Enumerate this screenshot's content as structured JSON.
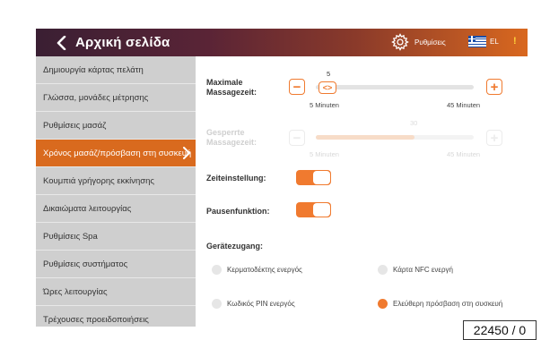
{
  "header": {
    "back_label": "Αρχική σελίδα",
    "settings_label": "Ρυθμίσεις",
    "lang_label": "EL",
    "info_glyph": "!"
  },
  "sidebar": {
    "items": [
      {
        "label": "Δημιουργία κάρτας πελάτη"
      },
      {
        "label": "Γλώσσα, μονάδες μέτρησης"
      },
      {
        "label": "Ρυθμίσεις μασάζ"
      },
      {
        "label": "Χρόνος μασάζ/πρόσβαση στη συσκευή",
        "active": true
      },
      {
        "label": "Κουμπιά γρήγορης εκκίνησης"
      },
      {
        "label": "Δικαιώματα λειτουργίας"
      },
      {
        "label": "Ρυθμίσεις Spa"
      },
      {
        "label": "Ρυθμίσεις συστήματος"
      },
      {
        "label": "Ώρες λειτουργίας"
      },
      {
        "label": "Τρέχουσες προειδοποιήσεις"
      }
    ]
  },
  "main": {
    "max_time": {
      "label": "Maximale Massagezeit:",
      "value": "5",
      "min_label": "5 Minuten",
      "max_label": "45 Minuten",
      "minus": "−",
      "plus": "+",
      "thumb_glyph": "<>"
    },
    "locked_time": {
      "label": "Gesperrte Massagezeit:",
      "value": "30",
      "min_label": "5 Minuten",
      "max_label": "45 Minuten",
      "minus": "−",
      "plus": "+"
    },
    "time_setting": {
      "label": "Zeiteinstellung:",
      "on": true
    },
    "pause_function": {
      "label": "Pausenfunktion:",
      "on": true
    },
    "device_access": {
      "label": "Gerätezugang:",
      "options": [
        {
          "label": "Κερματοδέκτης ενεργός",
          "selected": false
        },
        {
          "label": "Κάρτα NFC ενεργή",
          "selected": false
        },
        {
          "label": "Κωδικός PIN ενεργός",
          "selected": false
        },
        {
          "label": "Ελεύθερη πρόσβαση στη συσκευή",
          "selected": true
        }
      ]
    }
  },
  "footer": {
    "counter": "22450 / 0"
  },
  "colors": {
    "accent": "#f07a2f",
    "header_start": "#3a1f33",
    "header_end": "#d9681f",
    "sidebar_bg": "#cfcfcf",
    "active_bg": "#d96a1e"
  }
}
